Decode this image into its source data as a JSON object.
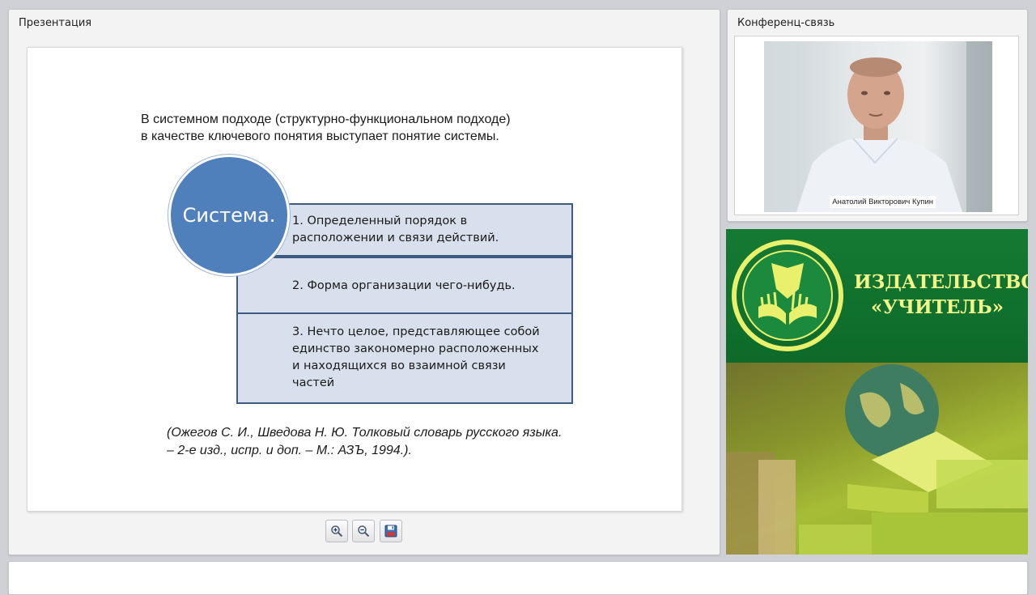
{
  "presentation": {
    "title": "Презентация",
    "slide": {
      "intro_line1": "В системном подходе (структурно-функциональном подходе)",
      "intro_line2": "в качестве ключевого понятия выступает понятие системы.",
      "circle_label": "Система.",
      "definitions": [
        {
          "line1": "1. Определенный порядок в",
          "line2": "расположении и связи действий."
        },
        {
          "line1": "2. Форма организации чего-нибудь."
        },
        {
          "line1": "3. Нечто целое, представляющее собой",
          "line2": "единство закономерно расположенных",
          "line3": "и находящихся во взаимной связи",
          "line4": "частей"
        }
      ],
      "citation_line1": "(Ожегов С. И., Шведова Н. Ю. Толковый словарь русского языка.",
      "citation_line2": "– 2-е изд., испр. и доп. – М.: АЗЪ, 1994.)."
    },
    "toolbar": {
      "zoom_in_icon": "zoom-in-icon",
      "zoom_out_icon": "zoom-out-icon",
      "save_icon": "floppy-disk-icon"
    }
  },
  "conference": {
    "title": "Конференц-связь",
    "speaker_name": "Анатолий Викторович Купин"
  },
  "publisher": {
    "name": "ИЗДАТЕЛЬСТВО\n«УЧИТЕЛЬ»"
  },
  "colors": {
    "circle": "#4f80bc",
    "box_fill": "#d7e0ec",
    "box_border": "#3d5a80",
    "banner_green": "#157a33",
    "banner_text": "#f2f58a"
  }
}
